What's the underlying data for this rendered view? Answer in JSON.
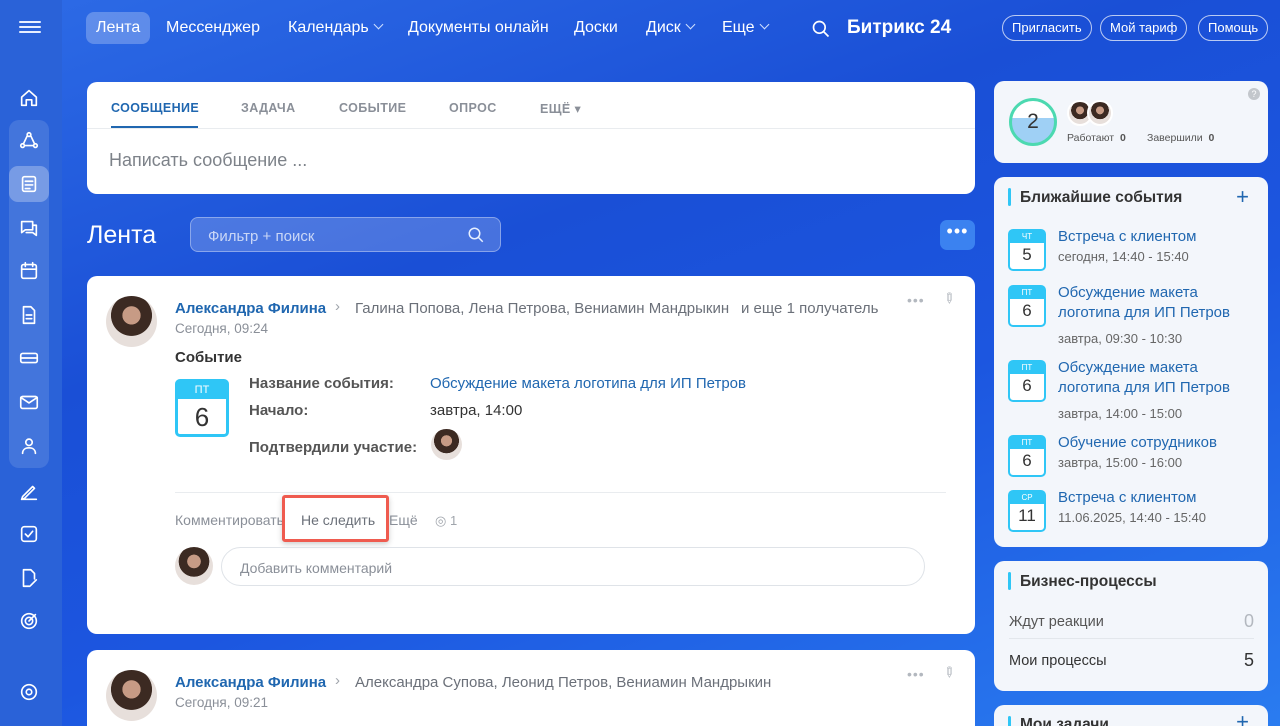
{
  "topnav": {
    "items": [
      "Лента",
      "Мессенджер",
      "Календарь",
      "Документы онлайн",
      "Доски",
      "Диск",
      "Еще"
    ],
    "brand": "Битрикс",
    "brand_num": "24",
    "invite": "Пригласить",
    "tariff": "Мой тариф",
    "help": "Помощь"
  },
  "composer": {
    "tabs": [
      "СООБЩЕНИЕ",
      "ЗАДАЧА",
      "СОБЫТИЕ",
      "ОПРОС",
      "ЕЩЁ"
    ],
    "placeholder": "Написать сообщение ..."
  },
  "feed": {
    "title": "Лента",
    "filter_placeholder": "Фильтр + поиск"
  },
  "post1": {
    "author": "Александра Филина",
    "recipients": "Галина Попова, Лена Петрова, Вениамин Мандрыкин",
    "more": "и еще 1 получатель",
    "time": "Сегодня, 09:24",
    "type": "Событие",
    "cal_day": "ПТ",
    "cal_num": "6",
    "name_label": "Название события:",
    "name_value": "Обсуждение макета логотипа для ИП Петров",
    "start_label": "Начало:",
    "start_value": "завтра, 14:00",
    "confirmed_label": "Подтвердили участие:",
    "comment": "Комментировать",
    "unfollow": "Не следить",
    "more_action": "Ещё",
    "views": "1",
    "comment_placeholder": "Добавить комментарий"
  },
  "post2": {
    "author": "Александра Филина",
    "recipients": "Александра Супова, Леонид Петров, Вениамин Мандрыкин",
    "time": "Сегодня, 09:21"
  },
  "status": {
    "count": "2",
    "working_label": "Работают",
    "working": "0",
    "finished_label": "Завершили",
    "finished": "0"
  },
  "events": {
    "title": "Ближайшие события",
    "items": [
      {
        "day": "ЧТ",
        "num": "5",
        "title": "Встреча с клиентом",
        "time": "сегодня, 14:40 - 15:40"
      },
      {
        "day": "ПТ",
        "num": "6",
        "title": "Обсуждение макета логотипа для ИП Петров",
        "time": "завтра, 09:30 - 10:30"
      },
      {
        "day": "ПТ",
        "num": "6",
        "title": "Обсуждение макета логотипа для ИП Петров",
        "time": "завтра, 14:00 - 15:00"
      },
      {
        "day": "ПТ",
        "num": "6",
        "title": "Обучение сотрудников",
        "time": "завтра, 15:00 - 16:00"
      },
      {
        "day": "СР",
        "num": "11",
        "title": "Встреча с клиентом",
        "time": "11.06.2025, 14:40 - 15:40"
      }
    ]
  },
  "bp": {
    "title": "Бизнес-процессы",
    "waiting_label": "Ждут реакции",
    "waiting": "0",
    "mine_label": "Мои процессы",
    "mine": "5"
  },
  "tasks": {
    "title": "Мои задачи"
  },
  "colors": {
    "accent": "#2067b0",
    "highlight": "#ef5b4f",
    "calendar": "#2fc6f6"
  }
}
